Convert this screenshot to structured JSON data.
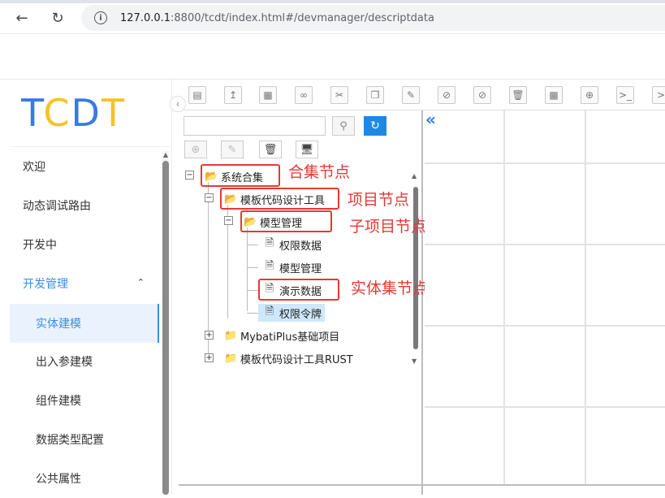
{
  "browser": {
    "url_host": "127.0.0.1",
    "url_path": ":8800/tcdt/index.html#/devmanager/descriptdata"
  },
  "logo": {
    "letters": [
      "T",
      "C",
      "D",
      "T"
    ]
  },
  "sidebar": {
    "items": [
      {
        "label": "欢迎"
      },
      {
        "label": "动态调试路由"
      },
      {
        "label": "开发中"
      },
      {
        "label": "开发管理"
      },
      {
        "label": "实体建模"
      },
      {
        "label": "出入参建模"
      },
      {
        "label": "组件建模"
      },
      {
        "label": "数据类型配置"
      },
      {
        "label": "公共属性"
      }
    ]
  },
  "tree": {
    "nodes": [
      {
        "label": "系统合集"
      },
      {
        "label": "模板代码设计工具"
      },
      {
        "label": "模型管理"
      },
      {
        "label": "权限数据"
      },
      {
        "label": "模型管理"
      },
      {
        "label": "演示数据"
      },
      {
        "label": "权限令牌"
      },
      {
        "label": "MybatiPlus基础项目"
      },
      {
        "label": "模板代码设计工具RUST"
      }
    ]
  },
  "annotations": {
    "collection_node": "合集节点",
    "project_node": "项目节点",
    "subproject_node": "子项目节点",
    "entity_collection_node": "实体集节点"
  },
  "colors": {
    "accent": "#3a8ee6",
    "logo_blue": "#3a7be0",
    "logo_yellow": "#f5c324",
    "annotation_red": "#e53935",
    "selected_bg": "#cde8fb"
  }
}
